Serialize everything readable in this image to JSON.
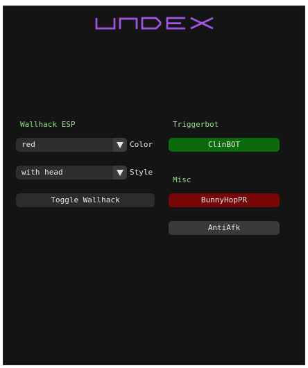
{
  "app": {
    "logo_text": "UNDEX",
    "logo_color": "#8a3fc9"
  },
  "wallhack": {
    "section_label": "Wallhack ESP",
    "color_combo": {
      "value": "red",
      "label": "Color"
    },
    "style_combo": {
      "value": "with head",
      "label": "Style"
    },
    "toggle_button_label": "Toggle Wallhack"
  },
  "triggerbot": {
    "section_label": "Triggerbot",
    "clinbot_button_label": "ClinBOT"
  },
  "misc": {
    "section_label": "Misc",
    "bunnyhop_button_label": "BunnyHopPR",
    "antiafk_button_label": "AntiAfk"
  },
  "colors": {
    "window_bg": "#141414",
    "section_label": "#8fe082",
    "clinbot_active": "#0b6a0b",
    "bunnyhop_active": "#780606",
    "inactive_button": "#3a3a3a"
  },
  "icons": {
    "combo_arrow": "triangle-down-icon"
  }
}
